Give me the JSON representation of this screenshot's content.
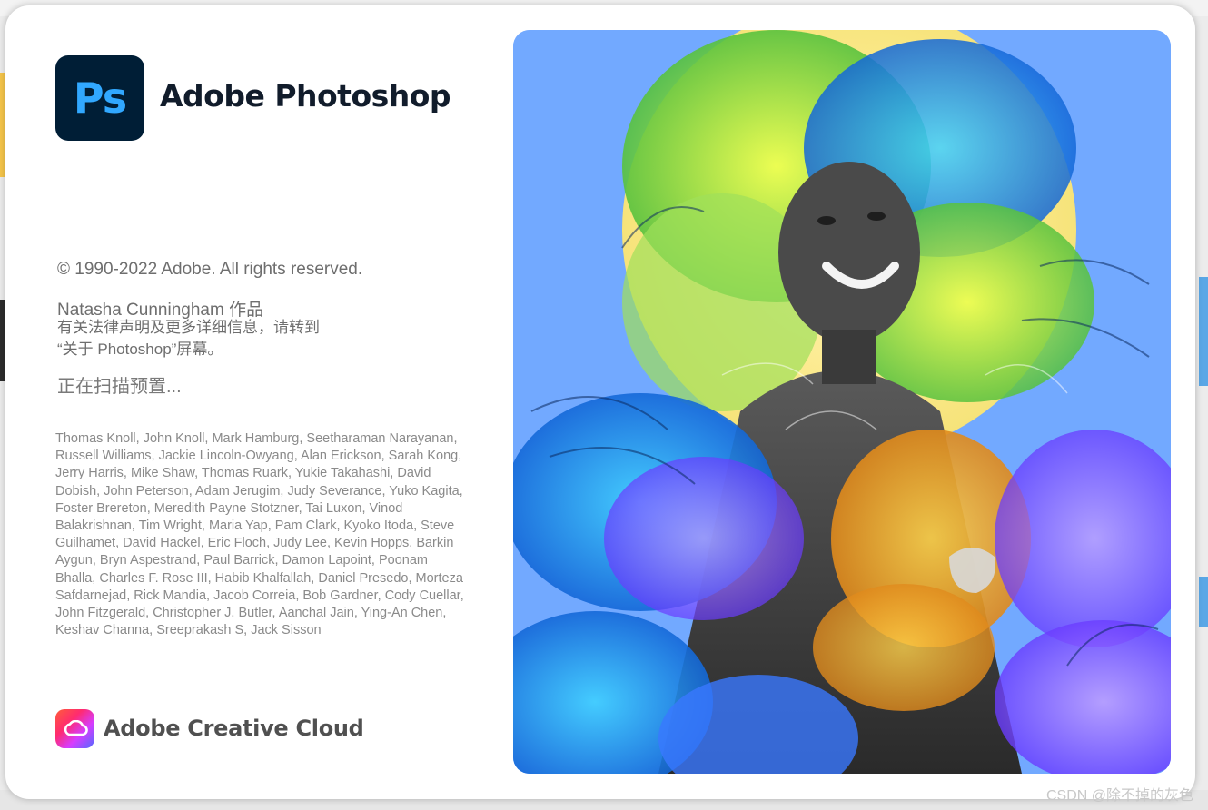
{
  "app": {
    "logo_text": "Ps",
    "title": "Adobe Photoshop"
  },
  "info": {
    "copyright": "© 1990-2022 Adobe. All rights reserved.",
    "artwork_by": "Natasha Cunningham 作品",
    "legal_line1": "有关法律声明及更多详细信息，请转到",
    "legal_line2": "“关于 Photoshop”屏幕。",
    "status": "正在扫描预置..."
  },
  "credits": "Thomas Knoll, John Knoll, Mark Hamburg, Seetharaman Narayanan, Russell Williams, Jackie Lincoln-Owyang, Alan Erickson, Sarah Kong, Jerry Harris, Mike Shaw, Thomas Ruark, Yukie Takahashi, David Dobish, John Peterson, Adam Jerugim, Judy Severance, Yuko Kagita, Foster Brereton, Meredith Payne Stotzner, Tai Luxon, Vinod Balakrishnan, Tim Wright, Maria Yap, Pam Clark, Kyoko Itoda, Steve Guilhamet, David Hackel, Eric Floch, Judy Lee, Kevin Hopps, Barkin Aygun, Bryn Aspestrand, Paul Barrick, Damon Lapoint, Poonam Bhalla, Charles F. Rose III, Habib Khalfallah, Daniel Presedo, Morteza Safdarnejad, Rick Mandia, Jacob Correia, Bob Gardner, Cody Cuellar, John Fitzgerald, Christopher J. Butler, Aanchal Jain, Ying-An Chen, Keshav Channa, Sreeprakash S, Jack Sisson",
  "footer": {
    "brand": "Adobe Creative Cloud"
  },
  "watermark": "CSDN @除不掉的灰色",
  "colors": {
    "ps_logo_bg": "#001e36",
    "ps_logo_text": "#31a8ff",
    "title_text": "#111c2b",
    "body_text": "#6e6e6e"
  }
}
